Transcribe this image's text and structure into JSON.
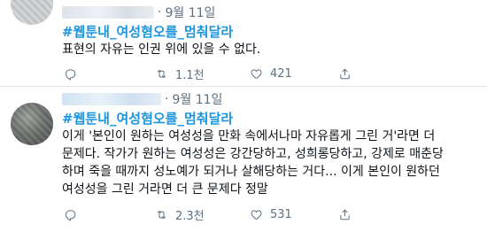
{
  "tweets": [
    {
      "date": "9월 11일",
      "hashtag": "#웹툰내_여성혐오를_멈춰달라",
      "text": "표현의 자유는 인권 위에 있을 수 없다.",
      "actions": {
        "reply_count": "",
        "retweet_count": "1.1천",
        "like_count": "421"
      }
    },
    {
      "date": "9월 11일",
      "hashtag": "#웹툰내_여성혐오를_멈춰달라",
      "text": "이게 '본인이 원하는 여성성을 만화 속에서나마 자유롭게 그린 거'라면 더\n문제다. 작가가 원하는 여성성은 강간당하고, 성희롱당하고, 강제로 매춘당\n하며 죽을 때까지 성노예가 되거나 살해당하는 거다... 이게 본인이 원하던\n여성성을 그린 거라면 더 큰 문제다 정말",
      "actions": {
        "reply_count": "",
        "retweet_count": "2.3천",
        "like_count": "531"
      }
    }
  ],
  "icons": {
    "reply": "reply-icon",
    "retweet": "retweet-icon",
    "like": "heart-icon",
    "share": "share-icon"
  },
  "colors": {
    "hashtag": "#1b95e0",
    "secondary_text": "#5b7083",
    "divider": "#e1e8ed"
  }
}
